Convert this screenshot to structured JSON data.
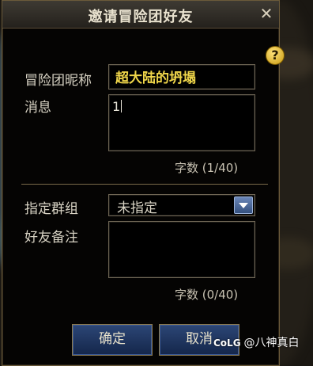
{
  "dialog": {
    "title": "邀请冒险团好友",
    "close_glyph": "✕",
    "help_glyph": "?",
    "nickname": {
      "label": "冒险团昵称",
      "value": "超大陆的坍塌"
    },
    "message": {
      "label": "消息",
      "value": "1",
      "count": "字数 (1/40)"
    },
    "group": {
      "label": "指定群组",
      "value": "未指定"
    },
    "note": {
      "label": "好友备注",
      "value": "",
      "count": "字数 (0/40)"
    },
    "buttons": {
      "confirm": "确定",
      "cancel": "取消"
    }
  },
  "watermark": {
    "logo": "CoLG",
    "text": "@八神真白"
  },
  "colors": {
    "accent": "#f0d64a",
    "button": "#1e3560",
    "border": "#6f6655"
  }
}
